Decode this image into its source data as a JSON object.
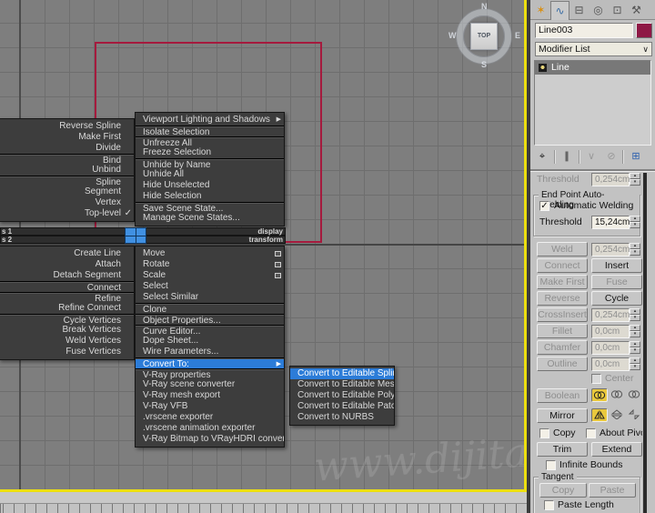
{
  "viewport": {
    "viewcube_label": "TOP",
    "compass": {
      "n": "N",
      "s": "S",
      "e": "E",
      "w": "W"
    },
    "watermark": "www.dijitalde",
    "colors": {
      "background": "#7e7e7e",
      "grid": "#6e6e6e",
      "spline": "#a51a3d",
      "active_border": "#ecdf10"
    }
  },
  "quad": {
    "titles": {
      "t1_left": "s 1",
      "t1_right": "display",
      "t2_left": "s 2",
      "t2_right": "transform"
    },
    "upper_left": {
      "items": [
        {
          "label": "Reverse Spline"
        },
        {
          "label": "Make First"
        },
        {
          "label": "Divide"
        },
        {
          "label": "Bind",
          "sep": true
        },
        {
          "label": "Unbind"
        },
        {
          "label": "Spline",
          "sep": true
        },
        {
          "label": "Segment"
        },
        {
          "label": "Vertex"
        },
        {
          "label": "Top-level",
          "check": true
        }
      ]
    },
    "lower_left": {
      "items": [
        {
          "label": "Create Line"
        },
        {
          "label": "Attach"
        },
        {
          "label": "Detach Segment"
        },
        {
          "label": "Connect",
          "sep": true
        },
        {
          "label": "Refine",
          "sep": true
        },
        {
          "label": "Refine Connect"
        },
        {
          "label": "Cycle Vertices",
          "sep": true
        },
        {
          "label": "Break Vertices"
        },
        {
          "label": "Weld Vertices"
        },
        {
          "label": "Fuse Vertices"
        }
      ]
    },
    "upper_right": {
      "items": [
        {
          "label": "Viewport Lighting and Shadows",
          "arrow": true
        },
        {
          "label": "Isolate Selection",
          "sep": true
        },
        {
          "label": "Unfreeze All",
          "sep": true
        },
        {
          "label": "Freeze Selection"
        },
        {
          "label": "Unhide by Name",
          "sep": true
        },
        {
          "label": "Unhide All"
        },
        {
          "label": "Hide Unselected"
        },
        {
          "label": "Hide Selection"
        },
        {
          "label": "Save Scene State...",
          "sep": true
        },
        {
          "label": "Manage Scene States..."
        }
      ]
    },
    "lower_right": {
      "items": [
        {
          "label": "Move",
          "sbox": true
        },
        {
          "label": "Rotate",
          "sbox": true
        },
        {
          "label": "Scale",
          "sbox": true
        },
        {
          "label": "Select"
        },
        {
          "label": "Select Similar"
        },
        {
          "label": "Clone",
          "sep": true
        },
        {
          "label": "Object Properties...",
          "sep": true
        },
        {
          "label": "Curve Editor...",
          "sep": true
        },
        {
          "label": "Dope Sheet..."
        },
        {
          "label": "Wire Parameters..."
        },
        {
          "label": "Convert To:",
          "sep": true,
          "hl": true,
          "arrow": true
        },
        {
          "label": "V-Ray properties",
          "sep": true
        },
        {
          "label": "V-Ray scene converter"
        },
        {
          "label": "V-Ray mesh export"
        },
        {
          "label": "V-Ray VFB"
        },
        {
          "label": ".vrscene exporter"
        },
        {
          "label": ".vrscene animation exporter"
        },
        {
          "label": "V-Ray Bitmap to VRayHDRI converter"
        }
      ]
    },
    "submenu": {
      "items": [
        {
          "label": "Convert to Editable Spline",
          "hl": true
        },
        {
          "label": "Convert to Editable Mesh"
        },
        {
          "label": "Convert to Editable Poly"
        },
        {
          "label": "Convert to Editable Patch"
        },
        {
          "label": "Convert to NURBS"
        }
      ]
    },
    "highlight_color": "#2c7cd8"
  },
  "panel": {
    "tabs": {
      "create": "✶",
      "modify": "∿",
      "hierarchy": "⊟",
      "motion": "◎",
      "display": "⊡",
      "utilities": "⚒"
    },
    "object_name": "Line003",
    "object_color": "#8e1845",
    "modifier_list_label": "Modifier List",
    "modifier_list_chevron": "∨",
    "stack_item": "Line",
    "stack_tools": {
      "pin": "⌖",
      "show_end_result": "∥",
      "make_unique": "∨",
      "remove": "⊘",
      "configure": "⊞"
    },
    "rollout": {
      "prev_threshold": {
        "label": "Threshold",
        "value": "0,254cm"
      },
      "weld_group": {
        "title": "End Point Auto-Welding",
        "auto_weld_label": "Automatic Welding",
        "auto_weld_checked": "✓",
        "threshold_label": "Threshold",
        "threshold_value": "15,24cm"
      },
      "buttons": {
        "weld": "Weld",
        "weld_value": "0,254cm",
        "connect": "Connect",
        "insert": "Insert",
        "make_first": "Make First",
        "fuse": "Fuse",
        "reverse": "Reverse",
        "cycle": "Cycle",
        "cross_insert": "CrossInsert",
        "cross_insert_value": "0,254cm",
        "fillet": "Fillet",
        "fillet_value": "0,0cm",
        "chamfer": "Chamfer",
        "chamfer_value": "0,0cm",
        "outline": "Outline",
        "outline_value": "0,0cm",
        "center": "Center",
        "boolean": "Boolean",
        "mirror": "Mirror",
        "copy": "Copy",
        "about_pivot": "About Pivot",
        "trim": "Trim",
        "extend": "Extend",
        "infinite_bounds": "Infinite Bounds",
        "tangent_title": "Tangent",
        "tangent_copy": "Copy",
        "tangent_paste": "Paste",
        "paste_length": "Paste Length"
      },
      "selection_yellow": "#e9c83d"
    }
  }
}
